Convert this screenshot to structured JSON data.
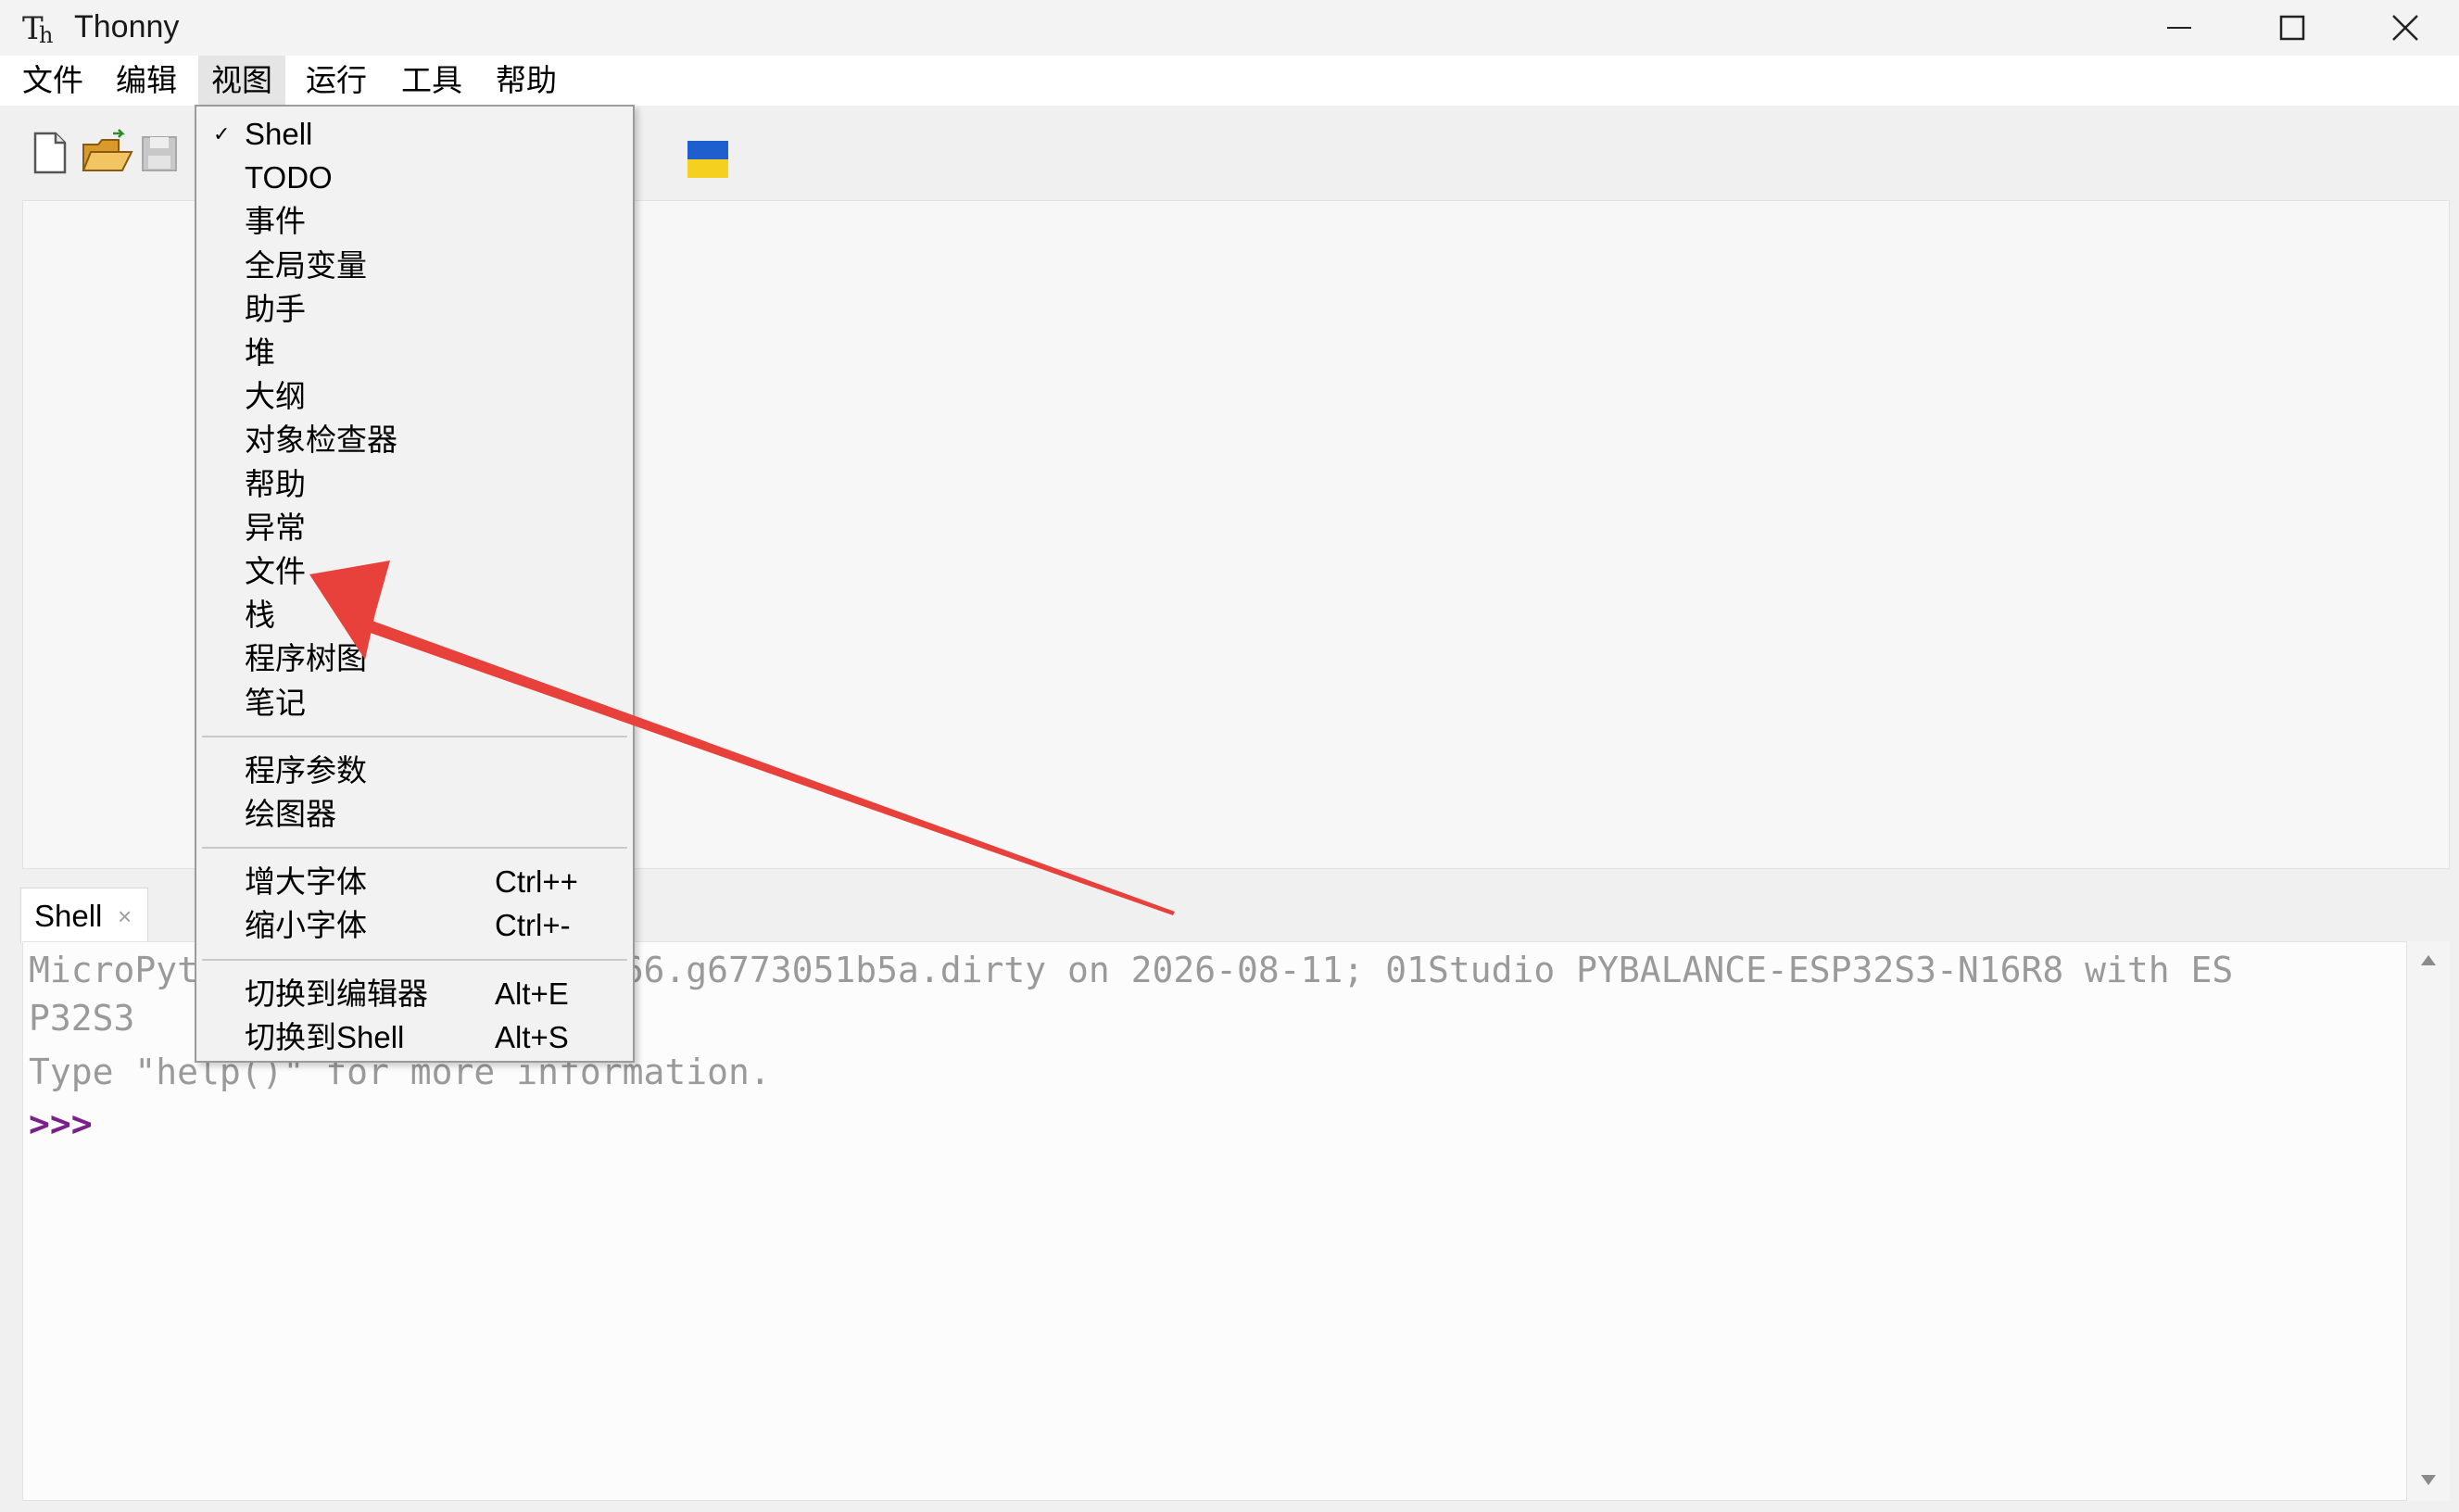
{
  "window": {
    "title": "Thonny",
    "icon": "thonny-logo-icon"
  },
  "menubar": {
    "items": [
      "文件",
      "编辑",
      "视图",
      "运行",
      "工具",
      "帮助"
    ],
    "active": "视图"
  },
  "toolbar": {
    "icons": [
      "new-file-icon",
      "open-folder-icon",
      "save-icon",
      "stop-icon",
      "ukraine-flag-icon"
    ]
  },
  "view_menu": {
    "groups": [
      [
        {
          "label": "Shell",
          "checked": true
        },
        {
          "label": "TODO"
        },
        {
          "label": "事件"
        },
        {
          "label": "全局变量"
        },
        {
          "label": "助手"
        },
        {
          "label": "堆"
        },
        {
          "label": "大纲"
        },
        {
          "label": "对象检查器"
        },
        {
          "label": "帮助"
        },
        {
          "label": "异常"
        },
        {
          "label": "文件"
        },
        {
          "label": "栈"
        },
        {
          "label": "程序树图"
        },
        {
          "label": "笔记"
        }
      ],
      [
        {
          "label": "程序参数"
        },
        {
          "label": "绘图器"
        }
      ],
      [
        {
          "label": "增大字体",
          "accel": "Ctrl++"
        },
        {
          "label": "缩小字体",
          "accel": "Ctrl+-"
        }
      ],
      [
        {
          "label": "切换到编辑器",
          "accel": "Alt+E"
        },
        {
          "label": "切换到Shell",
          "accel": "Alt+S"
        }
      ]
    ]
  },
  "shell": {
    "tab_label": "Shell",
    "tab_close": "×",
    "lines": [
      "MicroPyt                  .366.g6773051b5a.dirty on 2026-08-11; 01Studio PYBALANCE-ESP32S3-N16R8 with ES",
      "P32S3",
      "Type \"help()\" for more information."
    ],
    "prompt": ">>>"
  },
  "colors": {
    "arrow": "#e8403a",
    "prompt": "#7a1f8b"
  }
}
